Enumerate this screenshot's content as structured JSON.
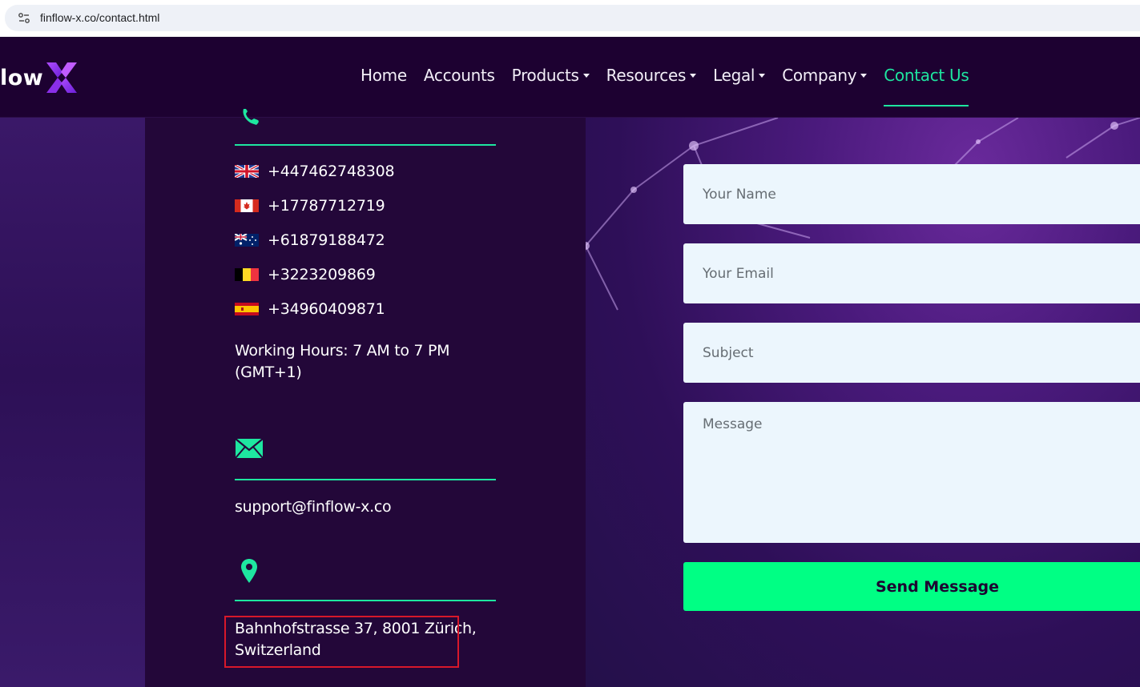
{
  "browser": {
    "url": "finflow-x.co/contact.html"
  },
  "nav": {
    "logo_text": "low",
    "items": [
      {
        "label": "Home",
        "dropdown": false,
        "active": false
      },
      {
        "label": "Accounts",
        "dropdown": false,
        "active": false
      },
      {
        "label": "Products",
        "dropdown": true,
        "active": false
      },
      {
        "label": "Resources",
        "dropdown": true,
        "active": false
      },
      {
        "label": "Legal",
        "dropdown": true,
        "active": false
      },
      {
        "label": "Company",
        "dropdown": true,
        "active": false
      },
      {
        "label": "Contact Us",
        "dropdown": false,
        "active": true
      }
    ]
  },
  "contact": {
    "phones": [
      {
        "country_flag": "uk-flag-icon",
        "number": "+447462748308"
      },
      {
        "country_flag": "canada-flag-icon",
        "number": "+17787712719"
      },
      {
        "country_flag": "australia-flag-icon",
        "number": "+61879188472"
      },
      {
        "country_flag": "belgium-flag-icon",
        "number": "+3223209869"
      },
      {
        "country_flag": "spain-flag-icon",
        "number": "+34960409871"
      }
    ],
    "working_hours_line1": "Working Hours: 7 AM to 7 PM",
    "working_hours_line2": "(GMT+1)",
    "email": "support@finflow-x.co",
    "address_line1": "Bahnhofstrasse 37, 8001 Zürich,",
    "address_line2": "Switzerland"
  },
  "form": {
    "name_placeholder": "Your Name",
    "email_placeholder": "Your Email",
    "subject_placeholder": "Subject",
    "message_placeholder": "Message",
    "submit_label": "Send Message"
  },
  "colors": {
    "accent": "#1ee6a0",
    "button": "#00ff84",
    "nav_bg": "#1d0131",
    "panel_bg": "#230739",
    "field_bg": "#ecf6fd",
    "highlight": "#d8182a"
  }
}
